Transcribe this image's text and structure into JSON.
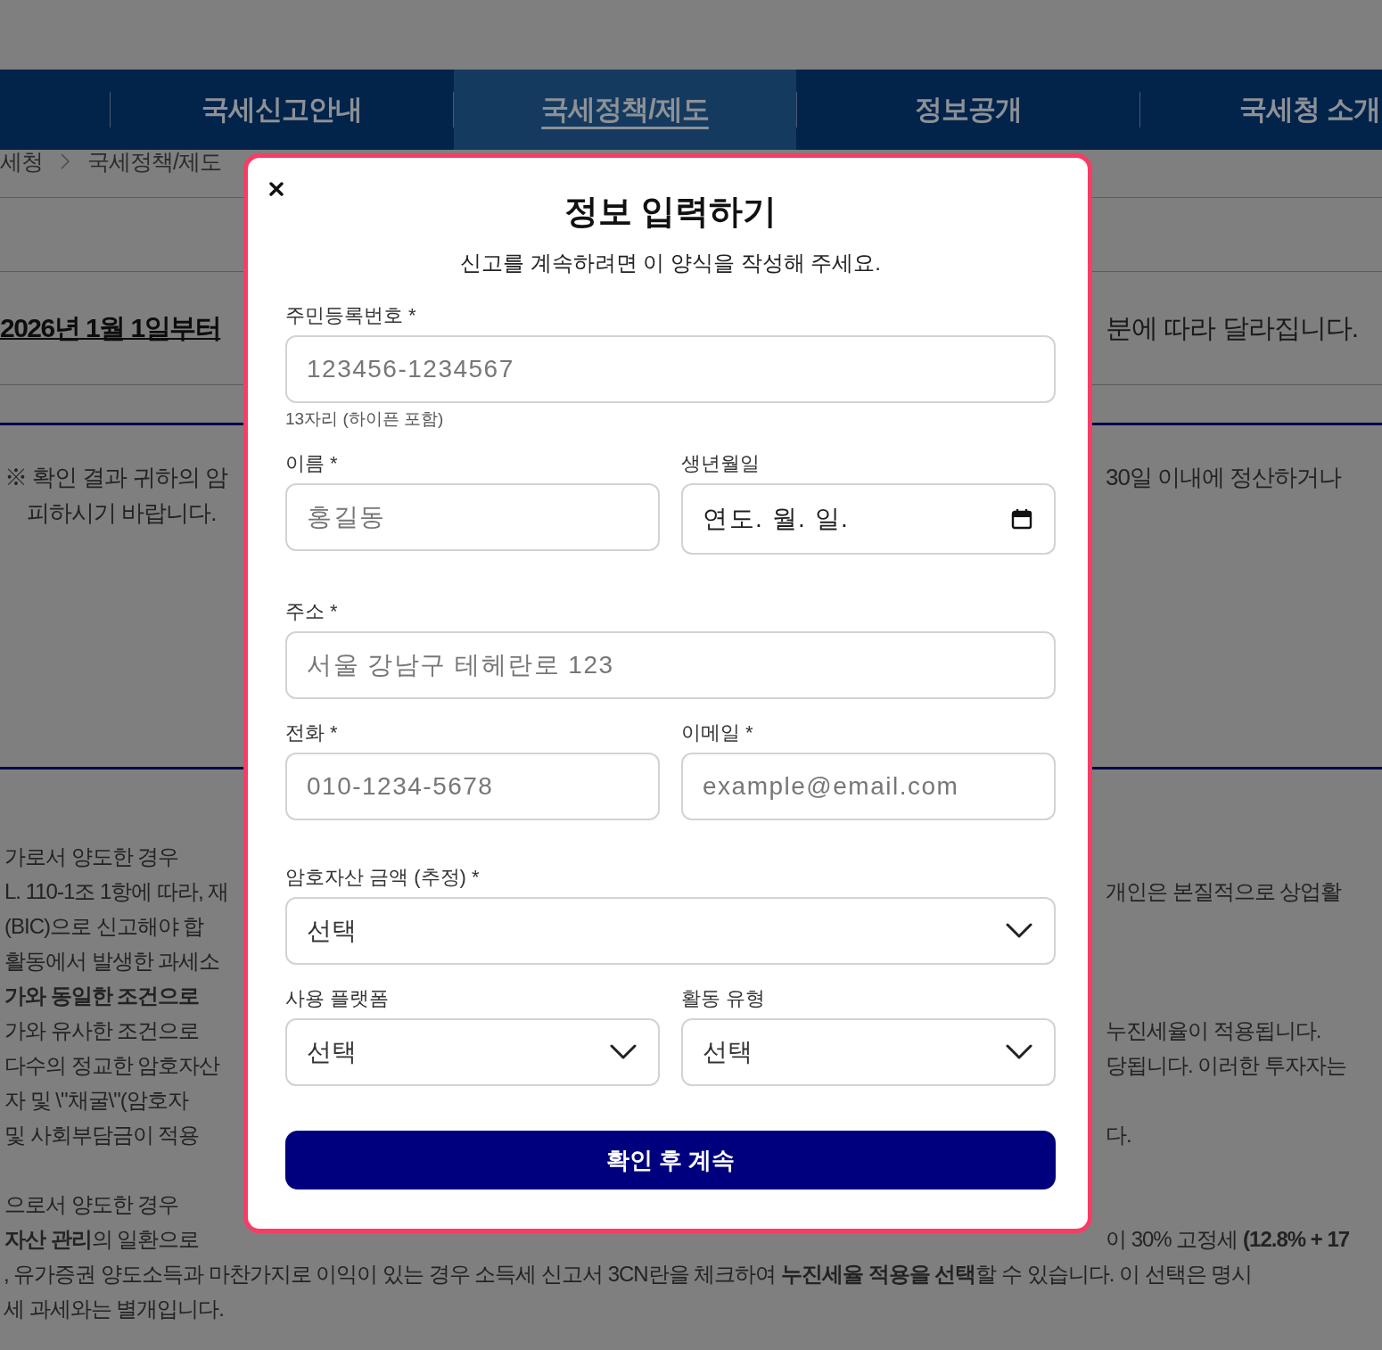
{
  "nav": {
    "items": [
      {
        "label": "국세신고안내",
        "selected": false
      },
      {
        "label": "국세정책/제도",
        "selected": true
      },
      {
        "label": "정보공개",
        "selected": false
      },
      {
        "label": "국세청 소개",
        "selected": false
      }
    ]
  },
  "breadcrumb": [
    "세청",
    "국세정책/제도"
  ],
  "heading": {
    "left": "2026년 1월 1일부터",
    "right": "분에 따라 달라집니다."
  },
  "notice": {
    "lines": [
      {
        "left": "※ 확인 결과 귀하의 암",
        "right": "30일 이내에 정산하거나"
      },
      {
        "left": "피하시기 바랍니다."
      }
    ]
  },
  "body": {
    "paragraphs": [
      {
        "lines": [
          {
            "left": "가로서 양도한 경우",
            "bold": false
          },
          {
            "left": "L. 110-1조 1항에 따라, 재",
            "right": "개인은 본질적으로 상업활",
            "bold": false
          },
          {
            "left": "(BIC)으로 신고해야 합",
            "bold": false
          },
          {
            "left": "활동에서 발생한 과세소",
            "bold": false
          },
          {
            "left": "가와 동일한 조건으로",
            "bold": true
          },
          {
            "left": "가와 유사한 조건으로",
            "right": "누진세율이 적용됩니다.",
            "bold": false
          },
          {
            "left": "다수의 정교한 암호자산",
            "right": "당됩니다. 이러한 투자자는",
            "bold": false
          },
          {
            "left": "자 및 \\\"채굴\\\"(암호자",
            "bold": false
          },
          {
            "left": "및 사회부담금이 적용",
            "right": "다.",
            "bold": false
          }
        ]
      },
      {
        "lines": [
          {
            "left": "으로서 양도한 경우",
            "bold": false
          },
          {
            "left": "**자산 관리**의 일환으로",
            "right": "이 30% 고정세 **(12.8% + 17**",
            "bold": false
          }
        ]
      }
    ],
    "full_lines": [
      ", 유가증권 양도소득과 마찬가지로 이익이 있는 경우 소득세 신고서 3CN란을 체크하여 **누진세율 적용을 선택**할 수 있습니다. 이 선택은 명시",
      "세 과세와는 별개입니다."
    ]
  },
  "modal": {
    "title": "정보 입력하기",
    "subtitle": "신고를 계속하려면 이 양식을 작성해 주세요.",
    "rows": [
      {
        "fields": [
          {
            "kind": "text",
            "label": "주민등록번호 *",
            "placeholder": "123456-1234567",
            "hint": "13자리 (하이픈 포함)"
          }
        ]
      },
      {
        "fields": [
          {
            "kind": "text",
            "label": "이름 *",
            "placeholder": "홍길동"
          },
          {
            "kind": "date",
            "label": "생년월일",
            "placeholder": "연도. 월. 일."
          }
        ]
      },
      {
        "fields": [
          {
            "kind": "text",
            "label": "주소 *",
            "placeholder": "서울 강남구 테헤란로 123"
          }
        ]
      },
      {
        "fields": [
          {
            "kind": "text",
            "label": "전화 *",
            "placeholder": "010-1234-5678"
          },
          {
            "kind": "text",
            "label": "이메일 *",
            "placeholder": "example@email.com"
          }
        ]
      },
      {
        "fields": [
          {
            "kind": "select",
            "label": "암호자산 금액 (추정) *",
            "value": "선택"
          }
        ]
      },
      {
        "fields": [
          {
            "kind": "select",
            "label": "사용 플랫폼",
            "value": "선택"
          },
          {
            "kind": "select",
            "label": "활동 유형",
            "value": "선택"
          }
        ]
      }
    ],
    "submit": "확인 후 계속"
  }
}
